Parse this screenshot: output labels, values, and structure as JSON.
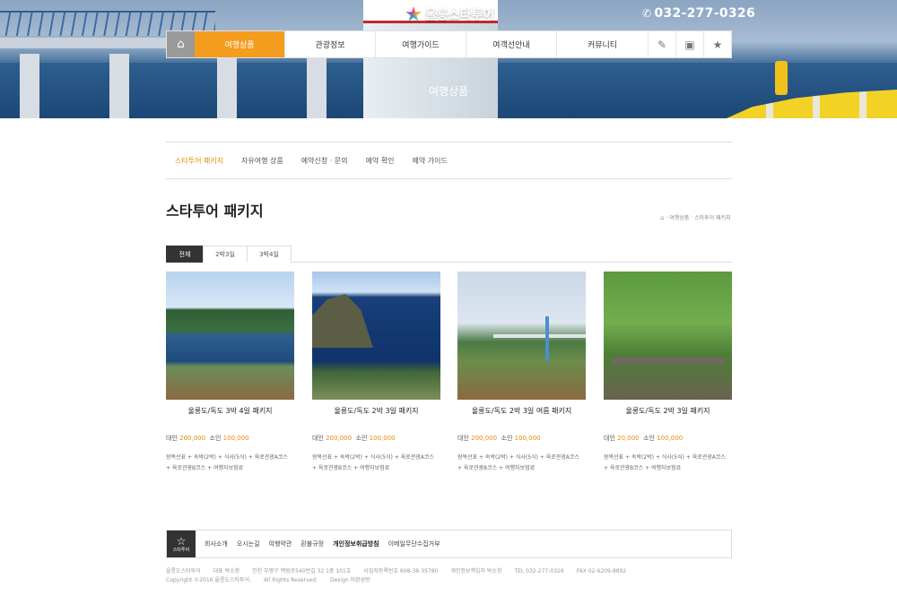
{
  "header": {
    "logo_text": "울릉스타투어",
    "phone": "032-277-0326",
    "hero_title": "여행상품"
  },
  "gnb": {
    "items": [
      {
        "label": "여행상품"
      },
      {
        "label": "관광정보"
      },
      {
        "label": "여행가이드"
      },
      {
        "label": "여객선안내"
      },
      {
        "label": "커뮤니티"
      }
    ],
    "active_index": 0
  },
  "subnav": {
    "items": [
      {
        "label": "스타투어 패키지"
      },
      {
        "label": "자유여행 상품"
      },
      {
        "label": "예약신청 · 문의"
      },
      {
        "label": "예약 확인"
      },
      {
        "label": "예약 가이드"
      }
    ],
    "active_index": 0
  },
  "page": {
    "title": "스타투어 패키지",
    "breadcrumb": "· 여행상품 · 스타투어 패키지"
  },
  "tabs": [
    {
      "label": "전체"
    },
    {
      "label": "2박3일"
    },
    {
      "label": "3박4일"
    }
  ],
  "products": [
    {
      "name": "울릉도/독도 3박 4일 패키지",
      "adult_label": "대인",
      "adult_price": "200,000",
      "child_label": "소인",
      "child_price": "100,000",
      "desc_line1": "왕복선표 + 숙박(2박) + 식사(5식) + 육로관광A코스",
      "desc_line2": "+ 육로관광B코스 + 여행자보험료"
    },
    {
      "name": "울릉도/독도 2박 3일 패키지",
      "adult_label": "대인",
      "adult_price": "200,000",
      "child_label": "소인",
      "child_price": "100,000",
      "desc_line1": "왕복선표 + 숙박(2박) + 식사(5식) + 육로관광A코스",
      "desc_line2": "+ 육로관광B코스 + 여행자보험료"
    },
    {
      "name": "울릉도/독도 2박 3일 여름 패키지",
      "adult_label": "대인",
      "adult_price": "200,000",
      "child_label": "소인",
      "child_price": "100,000",
      "desc_line1": "왕복선표 + 숙박(2박) + 식사(5식) + 육로관광A코스",
      "desc_line2": "+ 육로관광B코스 + 여행자보험료"
    },
    {
      "name": "울릉도/독도 2박 3일 패키지",
      "adult_label": "대인",
      "adult_price": "20,000",
      "child_label": "소인",
      "child_price": "100,000",
      "desc_line1": "왕복선표 + 숙박(2박) + 식사(5식) + 육로관광A코스",
      "desc_line2": "+ 육로관광B코스 + 여행자보험료"
    }
  ],
  "footer": {
    "logo_text": "스타투어",
    "links": [
      {
        "label": "회사소개"
      },
      {
        "label": "오시는길"
      },
      {
        "label": "여행약관"
      },
      {
        "label": "환불규정"
      },
      {
        "label": "개인정보취급방침"
      },
      {
        "label": "이메일무단수집거부"
      }
    ],
    "info": {
      "company": "울릉도스타투어",
      "ceo": "대표 박소향",
      "address": "인천 부평구 백범로540번길 32 1층 101호",
      "biz_no": "사업자등록번호 608-38-35780",
      "privacy": "개인정보책임자 박소향",
      "tel": "TEL 032-277-0326",
      "fax": "FAX 02-6209-8892",
      "copyright": "Copyright ©2016 울릉도스타투어.",
      "rights": "All Rights Reserved.",
      "design": "Design 미완성방"
    }
  }
}
